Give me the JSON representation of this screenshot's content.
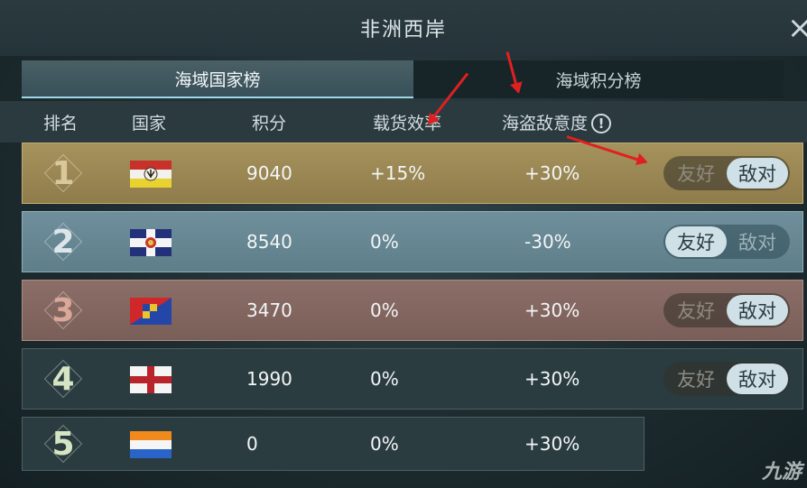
{
  "window": {
    "title": "非洲西岸",
    "close_icon": "×"
  },
  "tabs": [
    {
      "label": "海域国家榜",
      "active": true
    },
    {
      "label": "海域积分榜",
      "active": false
    }
  ],
  "columns": {
    "rank": "排名",
    "country": "国家",
    "score": "积分",
    "cargo": "载货效率",
    "pirate": "海盗敌意度",
    "pirate_info_icon": "!"
  },
  "toggle_labels": {
    "friendly": "友好",
    "hostile": "敌对"
  },
  "rows": [
    {
      "rank": "1",
      "score": "9040",
      "cargo": "+15%",
      "pirate": "+30%",
      "stance": "hostile",
      "flag": "flag-eagle-yellow"
    },
    {
      "rank": "2",
      "score": "8540",
      "cargo": "0%",
      "pirate": "-30%",
      "stance": "friendly",
      "flag": "flag-cross-crest"
    },
    {
      "rank": "3",
      "score": "3470",
      "cargo": "0%",
      "pirate": "+30%",
      "stance": "hostile",
      "flag": "flag-red-blue-checker"
    },
    {
      "rank": "4",
      "score": "1990",
      "cargo": "0%",
      "pirate": "+30%",
      "stance": "hostile",
      "flag": "flag-st-george-cross"
    },
    {
      "rank": "5",
      "score": "0",
      "cargo": "0%",
      "pirate": "+30%",
      "stance": "none",
      "flag": "flag-orange-white-blue"
    }
  ],
  "colors": {
    "rank1_row": "#a5925c",
    "rank2_row": "#6f8f9c",
    "rank3_row": "#8b6e67",
    "default_row": "#2b3c40",
    "toggle_on": "#cfe0e6",
    "annotation_arrow": "#e02020"
  },
  "watermark": "九游"
}
